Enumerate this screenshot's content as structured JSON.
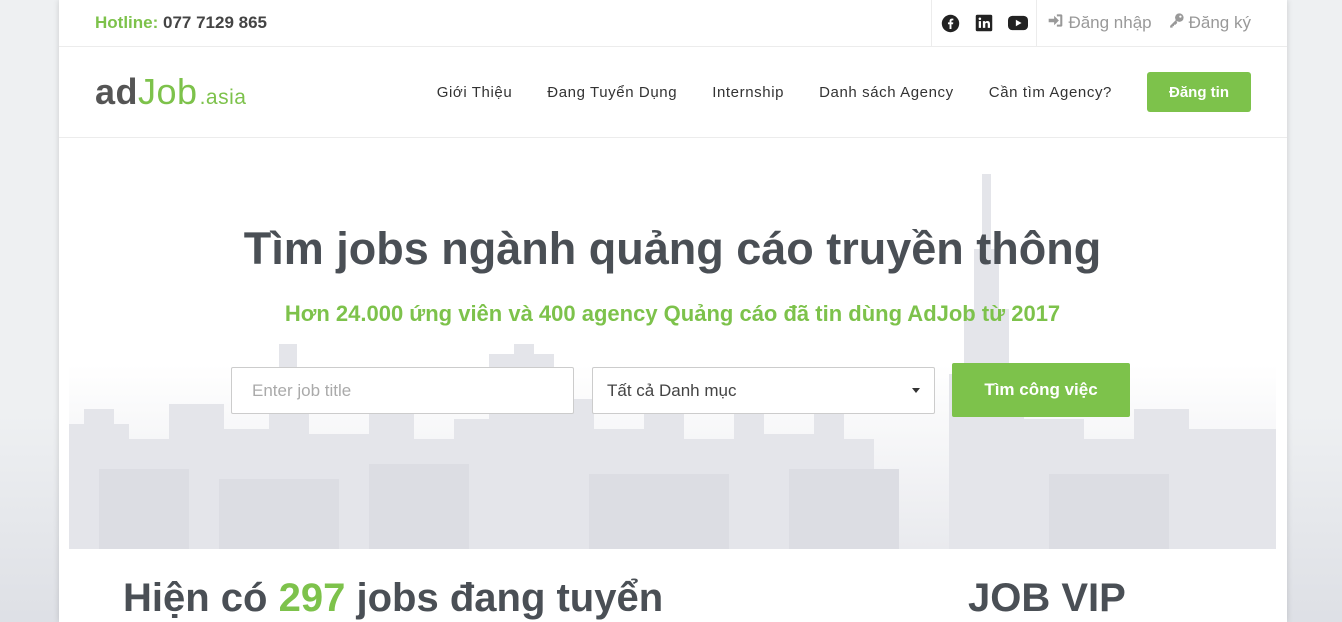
{
  "topbar": {
    "hotline_label": "Hotline:",
    "hotline_number": "077 7129 865",
    "socials": [
      "facebook-icon",
      "linkedin-icon",
      "youtube-icon"
    ],
    "login_label": "Đăng nhập",
    "register_label": "Đăng ký"
  },
  "logo": {
    "part1": "ad",
    "part2": "Job",
    "part3": ".asia"
  },
  "nav": {
    "items": [
      {
        "label": "Giới Thiệu"
      },
      {
        "label": "Đang Tuyển Dụng"
      },
      {
        "label": "Internship"
      },
      {
        "label": "Danh sách Agency"
      },
      {
        "label": "Cần tìm Agency?"
      }
    ],
    "post_button": "Đăng tin"
  },
  "hero": {
    "title": "Tìm jobs ngành quảng cáo truyền thông",
    "subtitle": "Hơn 24.000 ứng viên và 400 agency Quảng cáo đã tin dùng AdJob từ 2017",
    "search": {
      "placeholder": "Enter job title",
      "category_selected": "Tất cả Danh mục",
      "button_label": "Tìm công việc"
    }
  },
  "listing": {
    "heading_prefix": "Hiện có",
    "count": "297",
    "heading_suffix": "jobs đang tuyển",
    "vip_heading": "JOB VIP"
  },
  "colors": {
    "accent": "#7dc24b",
    "heading": "#4a4f55"
  }
}
